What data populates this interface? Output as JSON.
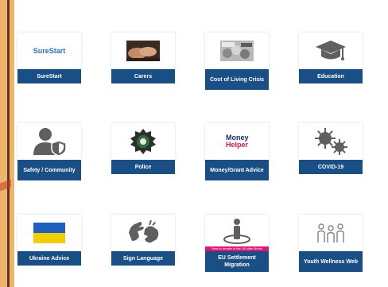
{
  "tiles": [
    {
      "label": "SureStart",
      "brand": "SureStart",
      "icon": "surestart-logo"
    },
    {
      "label": "Carers",
      "icon": "hands-photo-icon"
    },
    {
      "label": "Cost of Living Crisis",
      "icon": "coins-photo-icon"
    },
    {
      "label": "Education",
      "icon": "graduation-cap-icon"
    },
    {
      "label": "Safety / Community",
      "icon": "user-shield-icon"
    },
    {
      "label": "Police",
      "icon": "police-badge-icon"
    },
    {
      "label": "Money/Grant Advice",
      "brand_line1": "Money",
      "brand_line2": "Helper",
      "icon": "moneyhelper-logo"
    },
    {
      "label": "COVID-19",
      "icon": "virus-icon"
    },
    {
      "label": "Ukraine Advice",
      "icon": "ukraine-flag-icon"
    },
    {
      "label": "Sign Language",
      "icon": "sign-language-icon"
    },
    {
      "label": "EU Settlement Migration",
      "banner": "How to remain in the UK after Brexit",
      "icon": "person-location-icon"
    },
    {
      "label": "Youth Wellness Web",
      "icon": "youth-group-icon"
    }
  ],
  "colors": {
    "label_bg": "#1a4f86",
    "icon_grey": "#5f5f5f",
    "ukraine_blue": "#1f5fbf",
    "ukraine_yellow": "#f2cf00",
    "banner_pink": "#e0157a",
    "left_band": "#f0b36c"
  }
}
